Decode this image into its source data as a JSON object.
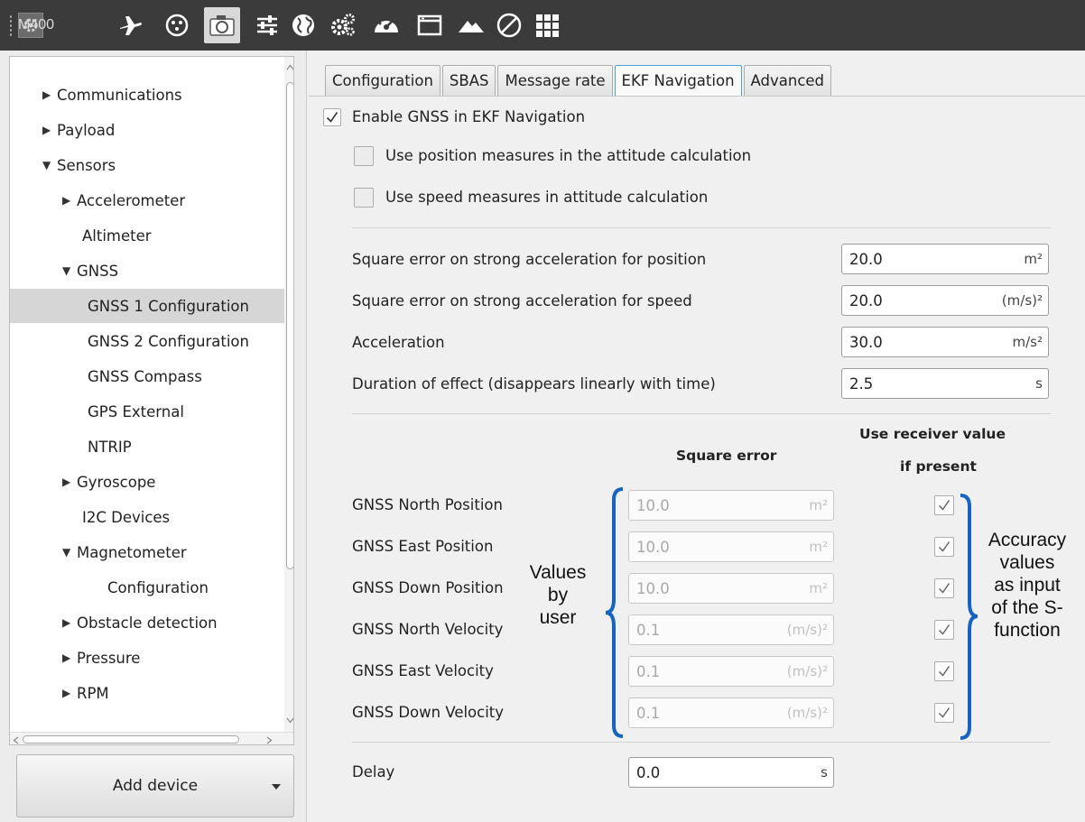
{
  "toolbar": {
    "device_label": "M400",
    "icons": [
      "gear-icon",
      "airplane-icon",
      "payload-icon",
      "camera-icon",
      "sliders-icon",
      "globe-icon",
      "gears-icon",
      "dashboard-icon",
      "window-icon",
      "mountain-icon",
      "disabled-icon",
      "grid-icon"
    ]
  },
  "tree": {
    "items": [
      {
        "label": "Communications",
        "arrow": "▶"
      },
      {
        "label": "Payload",
        "arrow": "▶"
      },
      {
        "label": "Sensors",
        "arrow": "▼"
      },
      {
        "label": "Accelerometer",
        "arrow": "▶"
      },
      {
        "label": "Altimeter",
        "arrow": ""
      },
      {
        "label": "GNSS",
        "arrow": "▼"
      },
      {
        "label": "GNSS 1 Configuration",
        "arrow": ""
      },
      {
        "label": "GNSS 2 Configuration",
        "arrow": ""
      },
      {
        "label": "GNSS Compass",
        "arrow": ""
      },
      {
        "label": "GPS External",
        "arrow": ""
      },
      {
        "label": "NTRIP",
        "arrow": ""
      },
      {
        "label": "Gyroscope",
        "arrow": "▶"
      },
      {
        "label": "I2C Devices",
        "arrow": ""
      },
      {
        "label": "Magnetometer",
        "arrow": "▼"
      },
      {
        "label": "Configuration",
        "arrow": ""
      },
      {
        "label": "Obstacle detection",
        "arrow": "▶"
      },
      {
        "label": "Pressure",
        "arrow": "▶"
      },
      {
        "label": "RPM",
        "arrow": "▶"
      }
    ],
    "add_device": "Add device"
  },
  "tabs": [
    "Configuration",
    "SBAS",
    "Message rate",
    "EKF Navigation",
    "Advanced"
  ],
  "ekf": {
    "enable_gnss": "Enable GNSS in EKF Navigation",
    "use_position": "Use position measures in the attitude calculation",
    "use_speed": "Use speed measures in attitude calculation",
    "params": [
      {
        "label": "Square error on strong acceleration for position",
        "value": "20.0",
        "unit": "m²"
      },
      {
        "label": "Square error on strong acceleration for speed",
        "value": "20.0",
        "unit": "(m/s)²"
      },
      {
        "label": "Acceleration",
        "value": "30.0",
        "unit": "m/s²"
      },
      {
        "label": "Duration of effect (disappears linearly with time)",
        "value": "2.5",
        "unit": "s"
      }
    ],
    "col_square_error": "Square error",
    "col_receiver_1": "Use receiver value",
    "col_receiver_2": "if present",
    "errors": [
      {
        "label": "GNSS North Position",
        "value": "10.0",
        "unit": "m²"
      },
      {
        "label": "GNSS East Position",
        "value": "10.0",
        "unit": "m²"
      },
      {
        "label": "GNSS Down Position",
        "value": "10.0",
        "unit": "m²"
      },
      {
        "label": "GNSS North Velocity",
        "value": "0.1",
        "unit": "(m/s)²"
      },
      {
        "label": "GNSS East Velocity",
        "value": "0.1",
        "unit": "(m/s)²"
      },
      {
        "label": "GNSS Down Velocity",
        "value": "0.1",
        "unit": "(m/s)²"
      }
    ],
    "delay_label": "Delay",
    "delay_value": "0.0",
    "delay_unit": "s"
  },
  "annotations": {
    "left": [
      "Values",
      "by",
      "user"
    ],
    "right": [
      "Accuracy",
      "values",
      "as input",
      "of the S-",
      "function"
    ]
  },
  "colors": {
    "brace": "#1565c0",
    "toolbar_bg": "#3b3b3b",
    "active_tab_border": "#4aa3df"
  }
}
